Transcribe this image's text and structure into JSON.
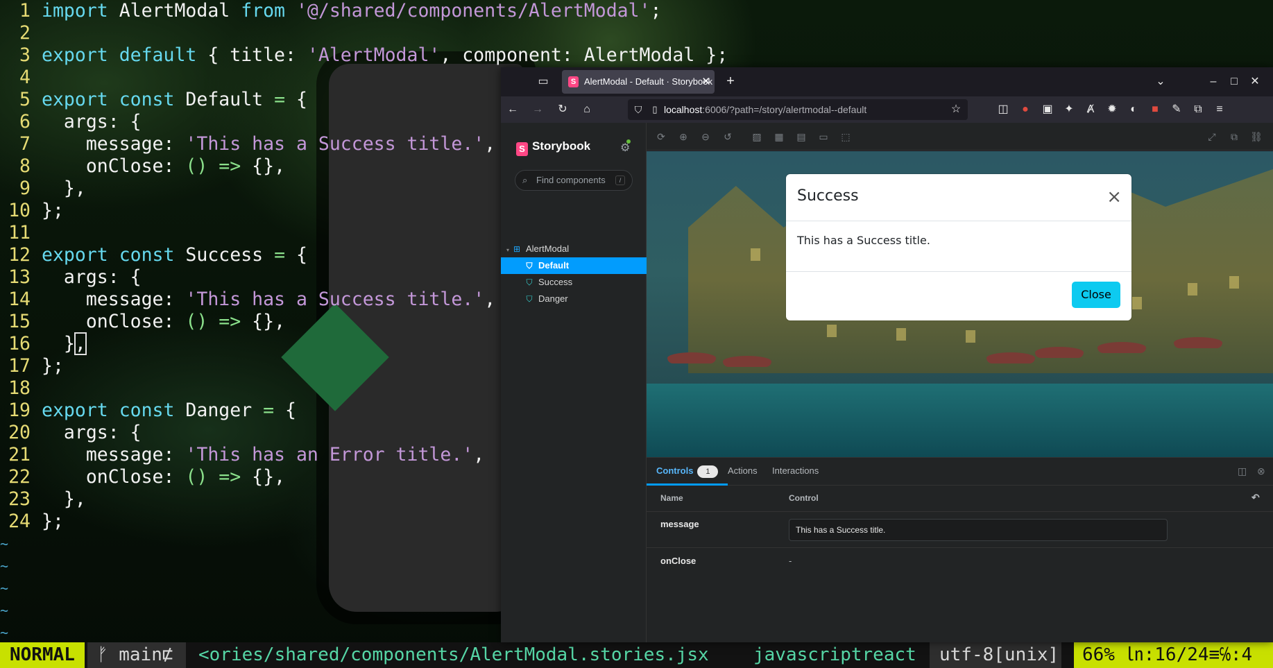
{
  "editor": {
    "lines": [
      {
        "n": "1"
      },
      {
        "n": "2"
      },
      {
        "n": "3"
      },
      {
        "n": "4"
      },
      {
        "n": "5"
      },
      {
        "n": "6"
      },
      {
        "n": "7"
      },
      {
        "n": "8"
      },
      {
        "n": "9"
      },
      {
        "n": "10"
      },
      {
        "n": "11"
      },
      {
        "n": "12"
      },
      {
        "n": "13"
      },
      {
        "n": "14"
      },
      {
        "n": "15"
      },
      {
        "n": "16"
      },
      {
        "n": "17"
      },
      {
        "n": "18"
      },
      {
        "n": "19"
      },
      {
        "n": "20"
      },
      {
        "n": "21"
      },
      {
        "n": "22"
      },
      {
        "n": "23"
      },
      {
        "n": "24"
      }
    ],
    "code": {
      "l1_import": "import",
      "l1_name": " AlertModal ",
      "l1_from": "from",
      "l1_path": " '@/shared/components/AlertModal'",
      "l1_end": ";",
      "l3_export": "export",
      "l3_default": " default",
      "l3_rest": " { title: ",
      "l3_str": "'AlertModal'",
      "l3_end": ", component: AlertModal };",
      "l5_export": "export",
      "l5_const": " const",
      "l5_name": " Default ",
      "l5_eq": "=",
      "l5_brace": " {",
      "args": "  args: {",
      "msg_key": "    message: ",
      "msg_success": "'This has a Success title.'",
      "msg_error": "'This has an Error title.'",
      "comma": ",",
      "onclose_key": "    onClose: ",
      "arrow": "() =>",
      "arrow_end": " {},",
      "close_args": "  },",
      "close_obj": "};",
      "l12_name": " Success ",
      "l19_name": " Danger ",
      "l16_a": "  }",
      "l16_b": ","
    },
    "tilde": "~"
  },
  "statusline": {
    "mode": "NORMAL",
    "branch": "ᚠ main⋢",
    "filepath": "<ories/shared/components/AlertModal.stories.jsx",
    "filetype": "javascriptreact",
    "encoding": "utf-8[unix]",
    "position": "66% ㏑:16/24≡℅:4"
  },
  "browser": {
    "tab_title": "AlertModal - Default · Storybook",
    "url_host": "localhost",
    "url_rest": ":6006/?path=/story/alertmodal--default",
    "new_tab": "+"
  },
  "storybook": {
    "brand": "Storybook",
    "search_placeholder": "Find components",
    "search_shortcut": "/",
    "tree": {
      "component": "AlertModal",
      "stories": [
        "Default",
        "Success",
        "Danger"
      ]
    },
    "modal": {
      "title": "Success",
      "close_x": "×",
      "body": "This has a Success title.",
      "close_button": "Close"
    },
    "panel": {
      "tabs": [
        "Controls",
        "Actions",
        "Interactions"
      ],
      "controls_count": "1",
      "header_name": "Name",
      "header_control": "Control",
      "rows": [
        {
          "name": "message",
          "value": "This has a Success title."
        },
        {
          "name": "onClose",
          "value": "-"
        }
      ]
    }
  },
  "colors": {
    "storybook_accent": "#029cfd",
    "storybook_brand": "#ff4785",
    "modal_close_button": "#0dcaf0",
    "vim_mode_bg": "#c8e000"
  }
}
